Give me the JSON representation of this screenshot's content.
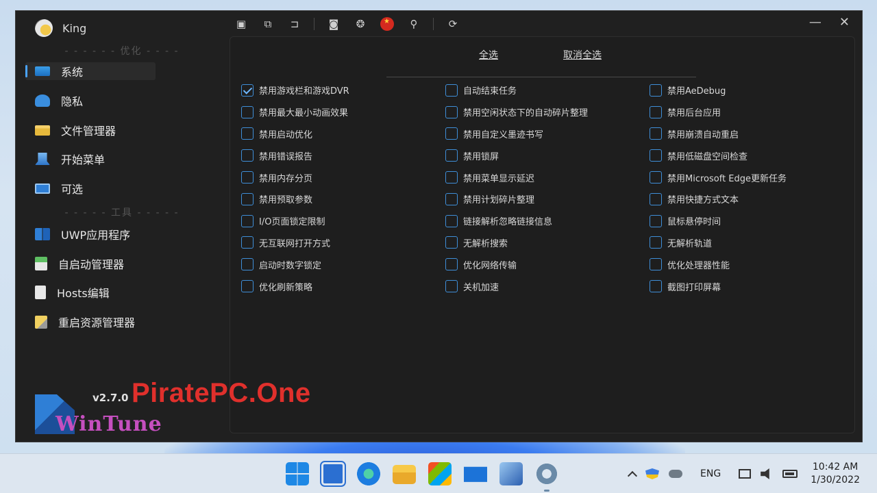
{
  "app": {
    "user_name": "King",
    "version": "v2.7.0",
    "brand_name": "WinTune"
  },
  "watermark": "PiratePC.One",
  "sidebar": {
    "section_optimize": "- - - - - - 优化 - - - - -",
    "section_tools": "- - - - - 工具 - - - - -",
    "items": [
      {
        "label": "系统",
        "icon": "system-icon",
        "active": true
      },
      {
        "label": "隐私",
        "icon": "privacy-icon"
      },
      {
        "label": "文件管理器",
        "icon": "folder-icon"
      },
      {
        "label": "开始菜单",
        "icon": "start-menu-icon"
      },
      {
        "label": "可选",
        "icon": "optional-icon"
      }
    ],
    "tools": [
      {
        "label": "UWP应用程序",
        "icon": "uwp-icon"
      },
      {
        "label": "自启动管理器",
        "icon": "autostart-icon"
      },
      {
        "label": "Hosts编辑",
        "icon": "hosts-icon"
      },
      {
        "label": "重启资源管理器",
        "icon": "restart-explorer-icon"
      }
    ]
  },
  "toolbar": {
    "icons": [
      "save-icon",
      "save-all-icon",
      "open-folder-icon",
      "camera-icon",
      "palette-icon",
      "language-flag-icon",
      "search-icon",
      "refresh-icon"
    ]
  },
  "window_controls": {
    "minimize": "—",
    "close": "✕"
  },
  "content": {
    "select_all": "全选",
    "deselect_all": "取消全选",
    "columns": [
      [
        {
          "label": "禁用游戏栏和游戏DVR",
          "checked": true
        },
        {
          "label": "禁用最大最小动画效果",
          "checked": false
        },
        {
          "label": "禁用启动优化",
          "checked": false
        },
        {
          "label": "禁用错误报告",
          "checked": false
        },
        {
          "label": "禁用内存分页",
          "checked": false
        },
        {
          "label": "禁用预取参数",
          "checked": false
        },
        {
          "label": "I/O页面锁定限制",
          "checked": false
        },
        {
          "label": "无互联网打开方式",
          "checked": false
        },
        {
          "label": "启动时数字锁定",
          "checked": false
        },
        {
          "label": "优化刷新策略",
          "checked": false
        }
      ],
      [
        {
          "label": "自动结束任务",
          "checked": false
        },
        {
          "label": "禁用空闲状态下的自动碎片整理",
          "checked": false
        },
        {
          "label": "禁用自定义墨迹书写",
          "checked": false
        },
        {
          "label": "禁用锁屏",
          "checked": false
        },
        {
          "label": "禁用菜单显示延迟",
          "checked": false
        },
        {
          "label": "禁用计划碎片整理",
          "checked": false
        },
        {
          "label": "链接解析忽略链接信息",
          "checked": false
        },
        {
          "label": "无解析搜索",
          "checked": false
        },
        {
          "label": "优化网络传输",
          "checked": false
        },
        {
          "label": "关机加速",
          "checked": false
        }
      ],
      [
        {
          "label": "禁用AeDebug",
          "checked": false
        },
        {
          "label": "禁用后台应用",
          "checked": false
        },
        {
          "label": "禁用崩溃自动重启",
          "checked": false
        },
        {
          "label": "禁用低磁盘空间检查",
          "checked": false
        },
        {
          "label": "禁用Microsoft Edge更新任务",
          "checked": false
        },
        {
          "label": "禁用快捷方式文本",
          "checked": false
        },
        {
          "label": "鼠标悬停时间",
          "checked": false
        },
        {
          "label": "无解析轨道",
          "checked": false
        },
        {
          "label": "优化处理器性能",
          "checked": false
        },
        {
          "label": "截图打印屏幕",
          "checked": false
        }
      ]
    ]
  },
  "taskbar": {
    "apps": [
      "start-icon",
      "widgets-icon",
      "edge-icon",
      "file-explorer-icon",
      "store-icon",
      "mail-icon",
      "snipping-tool-icon",
      "settings-icon"
    ],
    "language": "ENG",
    "time": "10:42 AM",
    "date": "1/30/2022"
  }
}
